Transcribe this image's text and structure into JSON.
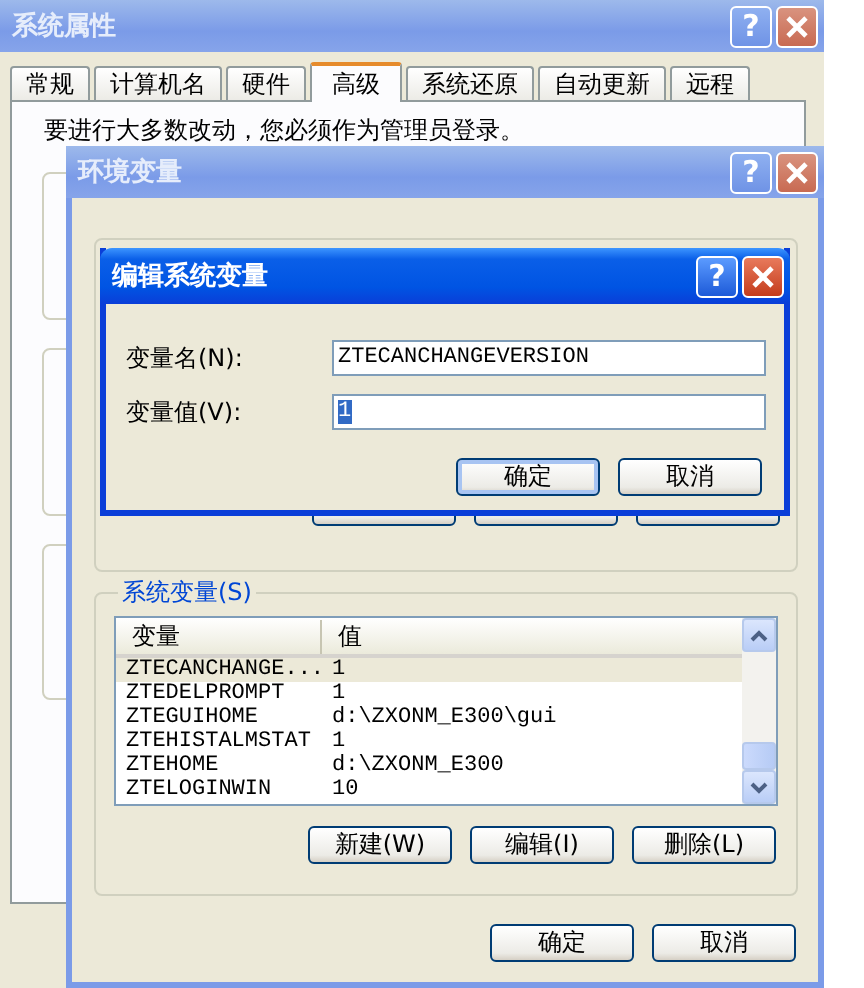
{
  "system_properties": {
    "title": "系统属性",
    "help_button": "?",
    "tabs": [
      {
        "label": "常规",
        "selected": false
      },
      {
        "label": "计算机名",
        "selected": false
      },
      {
        "label": "硬件",
        "selected": false
      },
      {
        "label": "高级",
        "selected": true
      },
      {
        "label": "系统还原",
        "selected": false
      },
      {
        "label": "自动更新",
        "selected": false
      },
      {
        "label": "远程",
        "selected": false
      }
    ],
    "notice": "要进行大多数改动，您必须作为管理员登录。"
  },
  "environment_variables": {
    "title": "环境变量",
    "help_button": "?",
    "system_group": {
      "label": "系统变量(S)",
      "columns": [
        "变量",
        "值"
      ],
      "rows": [
        {
          "name": "ZTECANCHANGE...",
          "value": "1",
          "selected": true
        },
        {
          "name": "ZTEDELPROMPT",
          "value": "1",
          "selected": false
        },
        {
          "name": "ZTEGUIHOME",
          "value": "d:\\ZXONM_E300\\gui",
          "selected": false
        },
        {
          "name": "ZTEHISTALMSTAT",
          "value": "1",
          "selected": false
        },
        {
          "name": "ZTEHOME",
          "value": "d:\\ZXONM_E300",
          "selected": false
        },
        {
          "name": "ZTELOGINWIN",
          "value": "10",
          "selected": false
        }
      ],
      "buttons": [
        "新建(W)",
        "编辑(I)",
        "删除(L)"
      ]
    },
    "buttons": [
      "确定",
      "取消"
    ]
  },
  "edit_dialog": {
    "title": "编辑系统变量",
    "help_button": "?",
    "fields": [
      {
        "label": "变量名(N):",
        "value": "ZTECANCHANGEVERSION",
        "selected": false
      },
      {
        "label": "变量值(V):",
        "value": "1",
        "selected": true
      }
    ],
    "buttons": [
      {
        "label": "确定",
        "default": true
      },
      {
        "label": "取消",
        "default": false
      }
    ]
  }
}
